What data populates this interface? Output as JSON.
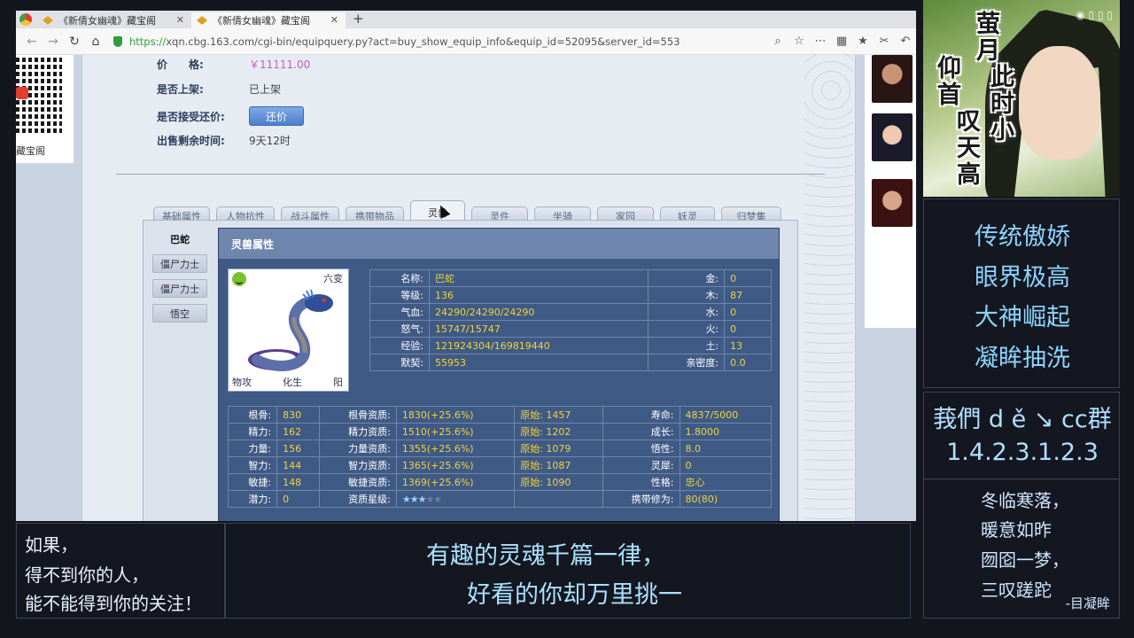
{
  "browser": {
    "tabs": [
      {
        "label": "《新倩女幽魂》藏宝阁",
        "active": false
      },
      {
        "label": "《新倩女幽魂》藏宝阁",
        "active": true
      }
    ],
    "new_tab": "+",
    "url_scheme": "https://",
    "url_rest": "xqn.cbg.163.com/cgi-bin/equipquery.py?act=buy_show_equip_info&equip_id=52095&server_id=553"
  },
  "left_strip": {
    "label": "藏宝阁"
  },
  "listing": {
    "price_label": "价　　格:",
    "price_value": "￥11111.00",
    "status_label": "是否上架:",
    "status_value": "已上架",
    "counter_label": "是否接受还价:",
    "counter_button": "还价",
    "remaining_label": "出售剩余时间:",
    "remaining_value": "9天12时"
  },
  "category_tabs": [
    "基础属性",
    "人物抗性",
    "战斗属性",
    "携带物品",
    "灵兽",
    "灵件",
    "坐骑",
    "家园",
    "妖灵",
    "归梦集"
  ],
  "active_category": 4,
  "pet_list": [
    "巴蛇",
    "僵尸力士",
    "僵尸力士",
    "悟空"
  ],
  "pet_box": {
    "title": "灵兽属性",
    "card": {
      "stage": "六变",
      "attack_type": "物攻",
      "phase": "化生",
      "yinyang": "阳"
    },
    "basic": [
      {
        "k1": "名称:",
        "v1": "巴蛇",
        "k2": "金:",
        "v2": "0"
      },
      {
        "k1": "等级:",
        "v1": "136",
        "k2": "木:",
        "v2": "87"
      },
      {
        "k1": "气血:",
        "v1": "24290/24290/24290",
        "k2": "水:",
        "v2": "0"
      },
      {
        "k1": "怒气:",
        "v1": "15747/15747",
        "k2": "火:",
        "v2": "0"
      },
      {
        "k1": "经验:",
        "v1": "121924304/169819440",
        "k2": "土:",
        "v2": "13"
      },
      {
        "k1": "默契:",
        "v1": "55953",
        "k2": "亲密度:",
        "v2": "0.0"
      }
    ],
    "attrs": [
      {
        "k1": "根骨:",
        "v1": "830",
        "k2": "根骨资质:",
        "v2": "1830(+25.6%)",
        "o": "原始: 1457",
        "k3": "寿命:",
        "v3": "4837/5000"
      },
      {
        "k1": "精力:",
        "v1": "162",
        "k2": "精力资质:",
        "v2": "1510(+25.6%)",
        "o": "原始: 1202",
        "k3": "成长:",
        "v3": "1.8000"
      },
      {
        "k1": "力量:",
        "v1": "156",
        "k2": "力量资质:",
        "v2": "1355(+25.6%)",
        "o": "原始: 1079",
        "k3": "悟性:",
        "v3": "8.0"
      },
      {
        "k1": "智力:",
        "v1": "144",
        "k2": "智力资质:",
        "v2": "1365(+25.6%)",
        "o": "原始: 1087",
        "k3": "灵犀:",
        "v3": "0"
      },
      {
        "k1": "敏捷:",
        "v1": "148",
        "k2": "敏捷资质:",
        "v2": "1369(+25.6%)",
        "o": "原始: 1090",
        "k3": "性格:",
        "v3": "忠心"
      },
      {
        "k1": "潜力:",
        "v1": "0",
        "k2": "资质星级:",
        "v2": "",
        "o": "",
        "k3": "携带修为:",
        "v3": "80(80)"
      }
    ],
    "star_rating": {
      "filled": 3,
      "total": 5
    }
  },
  "overlay": {
    "poster_title": [
      "萤",
      "月",
      "此",
      "时",
      "小",
      "仰",
      "首",
      "叹",
      "天",
      "高"
    ],
    "tags": [
      "传统傲娇",
      "眼界极高",
      "大神崛起",
      "凝眸抽洗"
    ],
    "group": [
      "莪們 d ě ↘ cc群",
      "1.4.2.3.1.2.3"
    ],
    "poem": [
      "冬临寒落，",
      "暖意如昨",
      "囫囵一梦，",
      "三叹蹉跎"
    ],
    "poem_sign": "-目凝眸",
    "subtitle_left": [
      "如果，",
      "得不到你的人，",
      "能不能得到你的关注！"
    ],
    "subtitle_main": [
      "有趣的灵魂千篇一律，",
      "好看的你却万里挑一"
    ]
  },
  "colors": {
    "accent_blue": "#4d7fcc",
    "value_yellow": "#f2d43a",
    "overlay_text": "#8ad4ff"
  }
}
